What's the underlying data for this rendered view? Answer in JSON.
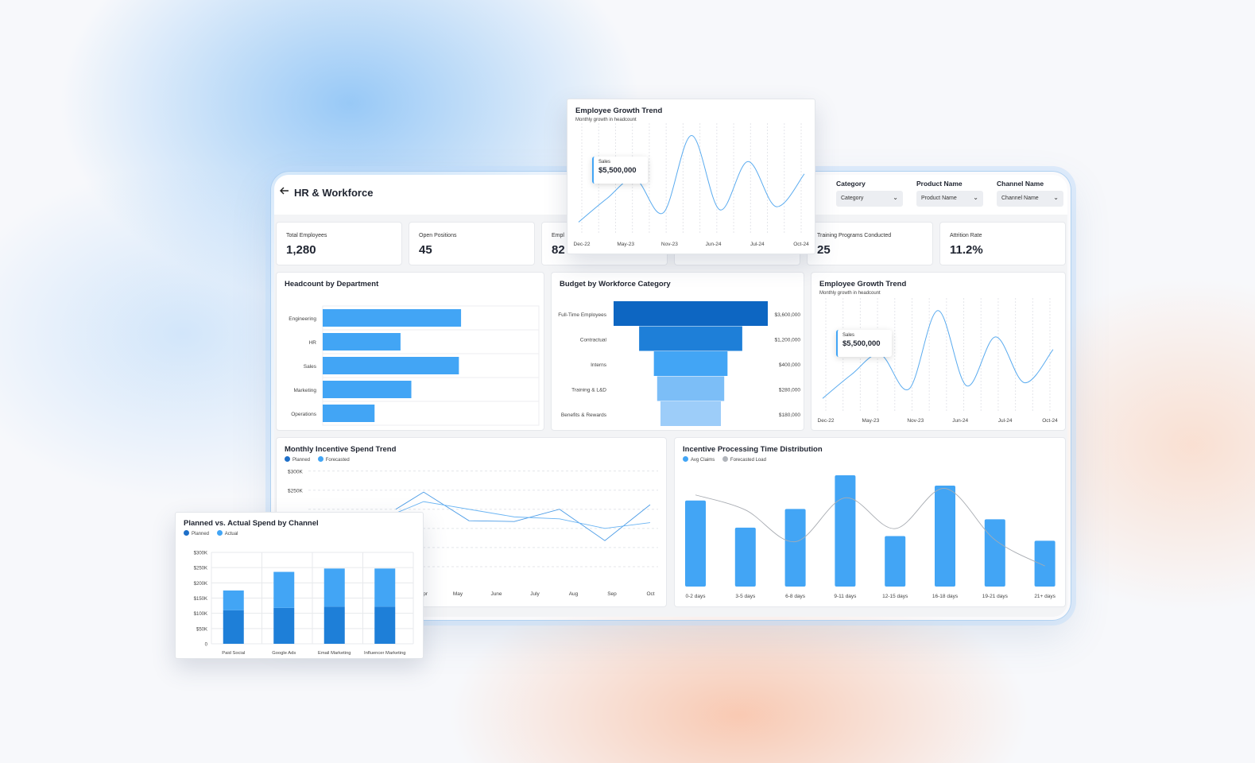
{
  "header": {
    "title": "HR & Workforce",
    "back_icon": "arrow-left-icon"
  },
  "filters": [
    {
      "label": "Category",
      "value": "Category"
    },
    {
      "label": "Product Name",
      "value": "Product Name"
    },
    {
      "label": "Channel Name",
      "value": "Channel Name"
    }
  ],
  "kpis": [
    {
      "label": "Total Employees",
      "value": "1,280"
    },
    {
      "label": "Open Positions",
      "value": "45"
    },
    {
      "label": "Empl",
      "value": "82"
    },
    {
      "label": "Training Programs Conducted",
      "value": "25"
    },
    {
      "label": "Attrition Rate",
      "value": "11.2%"
    }
  ],
  "headcount": {
    "title": "Headcount by Department",
    "chart_data": {
      "type": "bar",
      "orientation": "horizontal",
      "categories": [
        "Engineering",
        "HR",
        "Sales",
        "Marketing",
        "Operations"
      ],
      "values": [
        64,
        36,
        63,
        41,
        24
      ],
      "xlim": [
        0,
        100
      ],
      "color": "#42a5f5"
    }
  },
  "budget": {
    "title": "Budget by Workforce Category",
    "chart_data": {
      "type": "bar",
      "subtype": "funnel",
      "categories": [
        "Full-Time Employees",
        "Contractual",
        "Interns",
        "Training & L&D",
        "Benefits & Rewards"
      ],
      "values": [
        3600000,
        1200000,
        400000,
        280000,
        180000
      ],
      "value_labels": [
        "$3,600,000",
        "$1,200,000",
        "$400,000",
        "$280,000",
        "$180,000"
      ],
      "colors": [
        "#0d66c2",
        "#1e7fd8",
        "#42a5f5",
        "#7cbef7",
        "#9dcdf9"
      ]
    }
  },
  "growth": {
    "title": "Employee Growth Trend",
    "subtitle": "Monthly growth in headcount",
    "tooltip": {
      "label": "Sales",
      "value": "$5,500,000"
    },
    "chart_data": {
      "type": "line",
      "x_ticks": [
        "Dec-22",
        "May-23",
        "Nov-23",
        "Jun-24",
        "Jul-24",
        "Oct-24"
      ],
      "values": [
        20,
        58,
        90,
        35,
        160,
        40,
        118,
        45,
        98
      ],
      "ylim": [
        0,
        180
      ],
      "color": "#5aabef"
    }
  },
  "incentive_trend": {
    "title": "Monthly Incentive Spend Trend",
    "legend": [
      {
        "name": "Planned",
        "color": "#1e6fc8"
      },
      {
        "name": "Forecasted",
        "color": "#42a5f5"
      }
    ],
    "chart_data": {
      "type": "line",
      "categories": [
        "May",
        "June",
        "July",
        "Aug",
        "Sep",
        "Oct"
      ],
      "y_ticks": [
        "$300K",
        "$250K"
      ],
      "ylim": [
        0,
        320
      ],
      "series": [
        {
          "name": "Planned",
          "values": [
            245,
            170,
            168,
            200,
            118,
            212
          ]
        },
        {
          "name": "Forecasted",
          "values": [
            220,
            200,
            180,
            175,
            150,
            165
          ]
        }
      ]
    }
  },
  "processing": {
    "title": "Incentive Processing Time Distribution",
    "legend": [
      {
        "name": "Avg Claims",
        "color": "#42a5f5"
      },
      {
        "name": "Forecasted Load",
        "color": "#b0b4ba"
      }
    ],
    "chart_data": {
      "type": "bar",
      "categories": [
        "0-2 days",
        "3-5 days",
        "6-8 days",
        "9-11 days",
        "12-15 days",
        "16-18 days",
        "19-21 days",
        "21+ days"
      ],
      "series": [
        {
          "name": "Avg Claims",
          "values": [
            92,
            63,
            83,
            119,
            54,
            108,
            72,
            49
          ]
        },
        {
          "name": "Forecasted Load",
          "values": [
            98,
            82,
            48,
            95,
            62,
            105,
            50,
            22
          ]
        }
      ],
      "ylim": [
        0,
        125
      ]
    }
  },
  "channel_spend": {
    "title": "Planned vs. Actual Spend by Channel",
    "legend": [
      {
        "name": "Planned",
        "color": "#1e6fc8"
      },
      {
        "name": "Actual",
        "color": "#42a5f5"
      }
    ],
    "chart_data": {
      "type": "bar",
      "stacked": true,
      "categories": [
        "Paid Social",
        "Google Ads",
        "Email Marketing",
        "Influencer Marketing"
      ],
      "y_ticks": [
        "$300K",
        "$250K",
        "$200K",
        "$150K",
        "$100K",
        "$50K",
        "0"
      ],
      "ylim": [
        0,
        300000
      ],
      "series": [
        {
          "name": "Planned",
          "values": [
            110000,
            118000,
            122000,
            122000
          ]
        },
        {
          "name": "Actual",
          "values": [
            65000,
            118000,
            125000,
            125000
          ]
        }
      ]
    }
  }
}
